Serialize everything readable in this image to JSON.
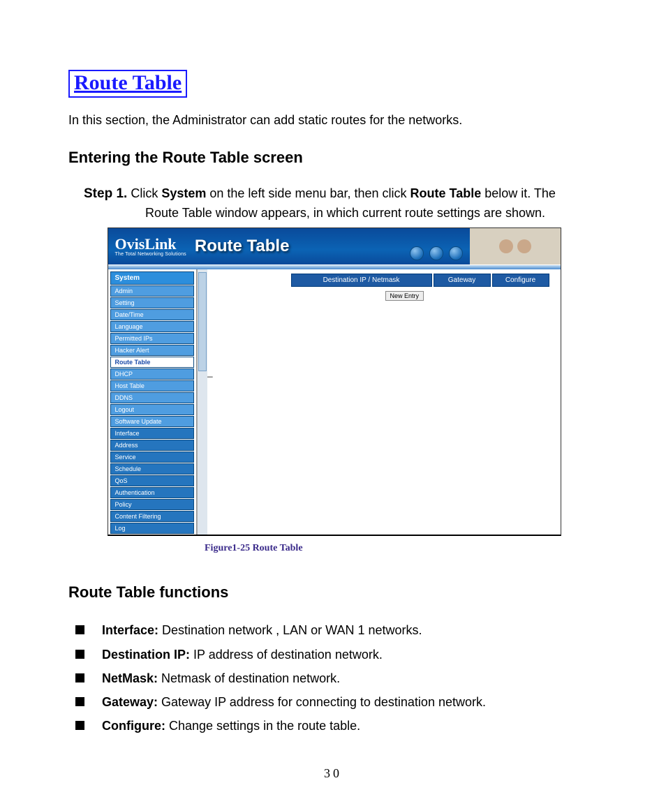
{
  "title": "Route Table",
  "intro": "In this section, the Administrator can add static routes for the networks.",
  "section1": "Entering the Route Table screen",
  "step": {
    "label": "Step 1.",
    "pre": "Click ",
    "b1": "System",
    "mid": " on the left side menu bar, then click ",
    "b2": "Route Table",
    "post": " below it. The",
    "line2": "Route Table window appears, in which current route settings are shown."
  },
  "shot": {
    "brand": "OvisLink",
    "tagline": "The Total Networking Solutions",
    "pageTitle": "Route Table",
    "sidebar": {
      "head": "System",
      "sub": [
        "Admin",
        "Setting",
        "Date/Time",
        "Language",
        "Permitted IPs",
        "Hacker Alert",
        "Route Table",
        "DHCP",
        "Host Table",
        "DDNS",
        "Logout",
        "Software Update"
      ],
      "sections": [
        "Interface",
        "Address",
        "Service",
        "Schedule",
        "QoS",
        "Authentication",
        "Policy",
        "Content Filtering",
        "Log"
      ]
    },
    "table": {
      "h1": "Destination IP / Netmask",
      "h2": "Gateway",
      "h3": "Configure",
      "newEntry": "New Entry"
    },
    "arrows": "←←"
  },
  "caption": "Figure1-25 Route Table",
  "section2": "Route Table functions",
  "funcs": [
    {
      "k": "Interface:",
      "v": " Destination network , LAN or WAN 1 networks."
    },
    {
      "k": "Destination IP:",
      "v": " IP address of destination network."
    },
    {
      "k": "NetMask:",
      "v": " Netmask of destination network."
    },
    {
      "k": "Gateway:",
      "v": " Gateway IP address for connecting to destination network."
    },
    {
      "k": "Configure:",
      "v": " Change settings in the route table."
    }
  ],
  "pageNumber": "30"
}
